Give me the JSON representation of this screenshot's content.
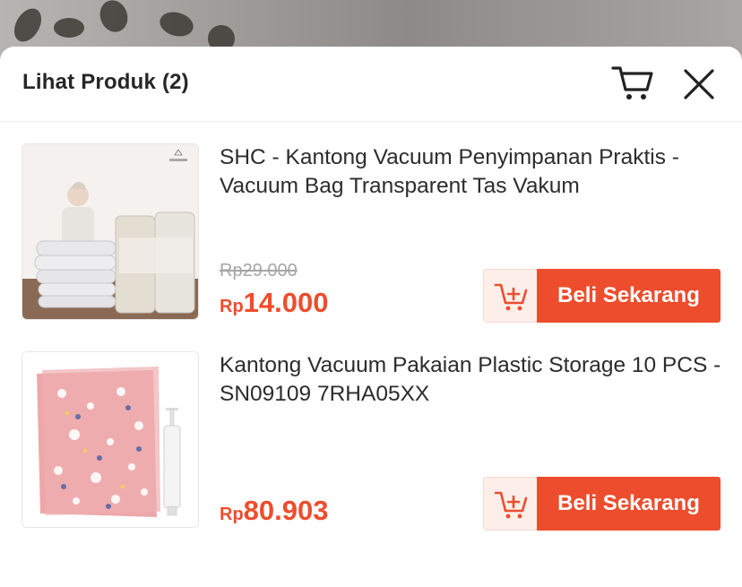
{
  "sheet": {
    "title": "Lihat Produk (2)"
  },
  "icons": {
    "cart": "cart-icon",
    "close": "close-icon",
    "add_to_cart": "add-to-cart-icon"
  },
  "colors": {
    "accent": "#ee4d2d",
    "accent_light": "#fdeeea",
    "text": "#2c2c2c",
    "muted": "#a6a6a6"
  },
  "products": [
    {
      "name": "SHC - Kantong Vacuum Penyimpanan Praktis - Vacuum Bag Transparent Tas Vakum",
      "original_price": "Rp29.000",
      "currency": "Rp",
      "price": "14.000",
      "buy_label": "Beli Sekarang"
    },
    {
      "name": "Kantong Vacuum Pakaian Plastic Storage 10 PCS - SN09109 7RHA05XX",
      "original_price": "",
      "currency": "Rp",
      "price": "80.903",
      "buy_label": "Beli Sekarang"
    }
  ]
}
